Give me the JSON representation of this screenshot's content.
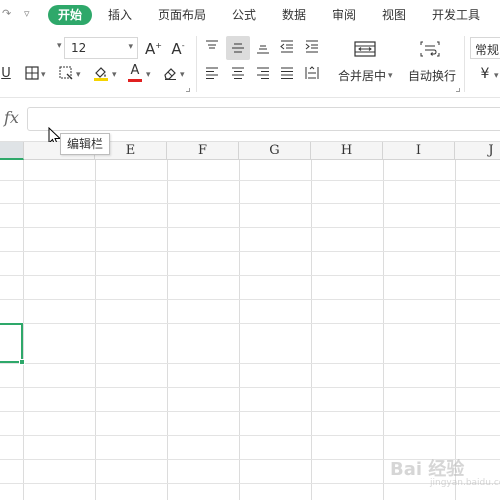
{
  "menu": {
    "redo_icon": "redo-icon",
    "more_icon": "chevron-down-icon",
    "tabs": [
      {
        "label": "开始",
        "active": true
      },
      {
        "label": "插入"
      },
      {
        "label": "页面布局"
      },
      {
        "label": "公式"
      },
      {
        "label": "数据"
      },
      {
        "label": "审阅"
      },
      {
        "label": "视图"
      },
      {
        "label": "开发工具"
      }
    ],
    "accent_color": "#2ea86a"
  },
  "ribbon": {
    "font_size": "12",
    "increase_font_icon": "A⁺",
    "decrease_font_icon": "A⁻",
    "underline_icon": "U",
    "border_icon": "border-icon",
    "fill_icon": "fill-color-icon",
    "font_color_icon": "A",
    "font_color": "#e02020",
    "fill_color": "#f5d400",
    "clear_icon": "eraser-icon",
    "merge_label": "合并居中",
    "wrap_label": "自动换行",
    "number_format": "常规",
    "currency_icon": "¥"
  },
  "formula_bar": {
    "fx_label": "fx",
    "value": "",
    "tooltip": "编辑栏"
  },
  "grid": {
    "columns": [
      "",
      "E",
      "F",
      "G",
      "H",
      "I",
      "J"
    ],
    "selected_column_index": 0
  },
  "watermark": {
    "text": "Bai 经验",
    "sub": "jingyan.baidu.com"
  }
}
